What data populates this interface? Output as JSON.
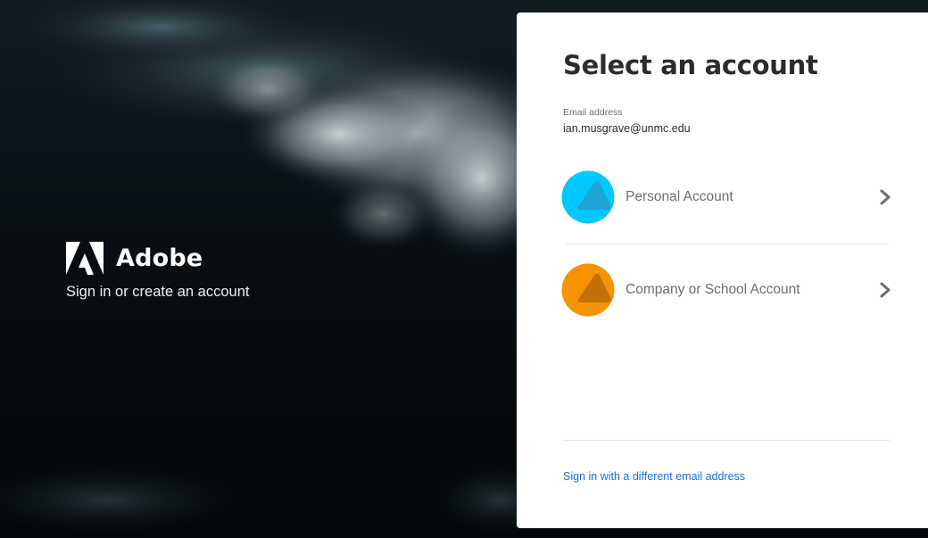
{
  "brand": {
    "logo_icon": "adobe-logo-icon",
    "name": "Adobe",
    "tagline": "Sign in or create an account"
  },
  "card": {
    "title": "Select an account",
    "email_label": "Email address",
    "email_value": "ian.musgrave@unmc.edu",
    "accounts": [
      {
        "label": "Personal Account",
        "icon": "personal-account-icon",
        "color": "#00c8ff",
        "accent": "#1ea5d4"
      },
      {
        "label": "Company or School Account",
        "icon": "company-account-icon",
        "color": "#f59300",
        "accent": "#c46f0a"
      }
    ],
    "chevron_icon": "chevron-right-icon",
    "alt_link": "Sign in with a different email address"
  },
  "colors": {
    "link": "#1473e6",
    "title": "#2c2c2c",
    "muted": "#6e6e6e",
    "background": "#05090b"
  }
}
